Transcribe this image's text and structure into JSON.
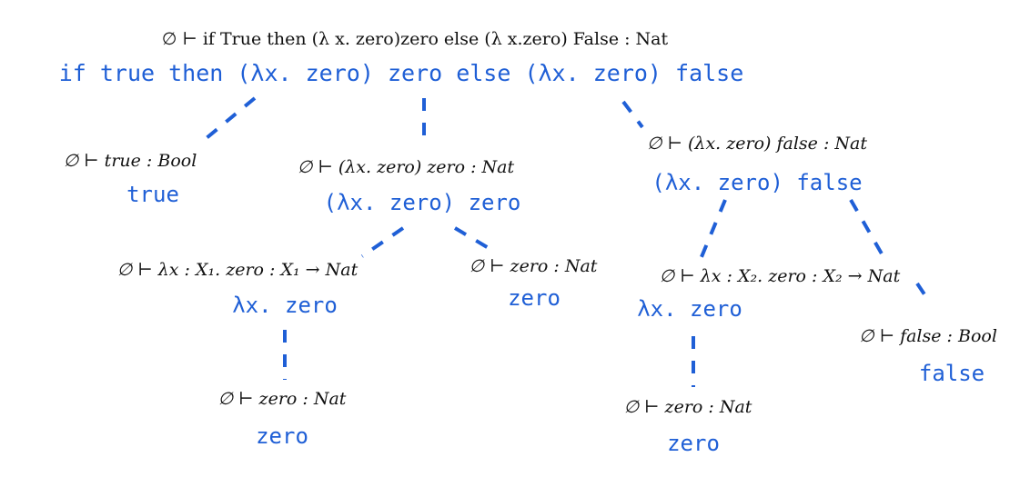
{
  "colors": {
    "term": "#1f5fd6",
    "judgement": "#111111",
    "edge": "#1f5fd6",
    "background": "#ffffff"
  },
  "nodes": {
    "root": {
      "judgement": "∅ ⊢ if True then (λ x. zero)zero else (λ x.zero) False : Nat",
      "term": "if true then (λx. zero) zero else (λx. zero) false"
    },
    "true_node": {
      "judgement": "∅ ⊢ true : Bool",
      "term": "true"
    },
    "app1": {
      "judgement": "∅ ⊢ (λx. zero) zero : Nat",
      "term": "(λx. zero) zero"
    },
    "app2": {
      "judgement": "∅ ⊢ (λx. zero) false : Nat",
      "term": "(λx. zero) false"
    },
    "lam1": {
      "judgement": "∅ ⊢ λx : X₁. zero : X₁ → Nat",
      "term": "λx. zero"
    },
    "zero_arg": {
      "judgement": "∅ ⊢ zero : Nat",
      "term": "zero"
    },
    "lam2": {
      "judgement": "∅ ⊢ λx : X₂. zero : X₂ → Nat",
      "term": "λx. zero"
    },
    "false_node": {
      "judgement": "∅ ⊢ false : Bool",
      "term": "false"
    },
    "zero_body1": {
      "judgement": "∅ ⊢ zero : Nat",
      "term": "zero"
    },
    "zero_body2": {
      "judgement": "∅ ⊢ zero : Nat",
      "term": "zero"
    }
  }
}
